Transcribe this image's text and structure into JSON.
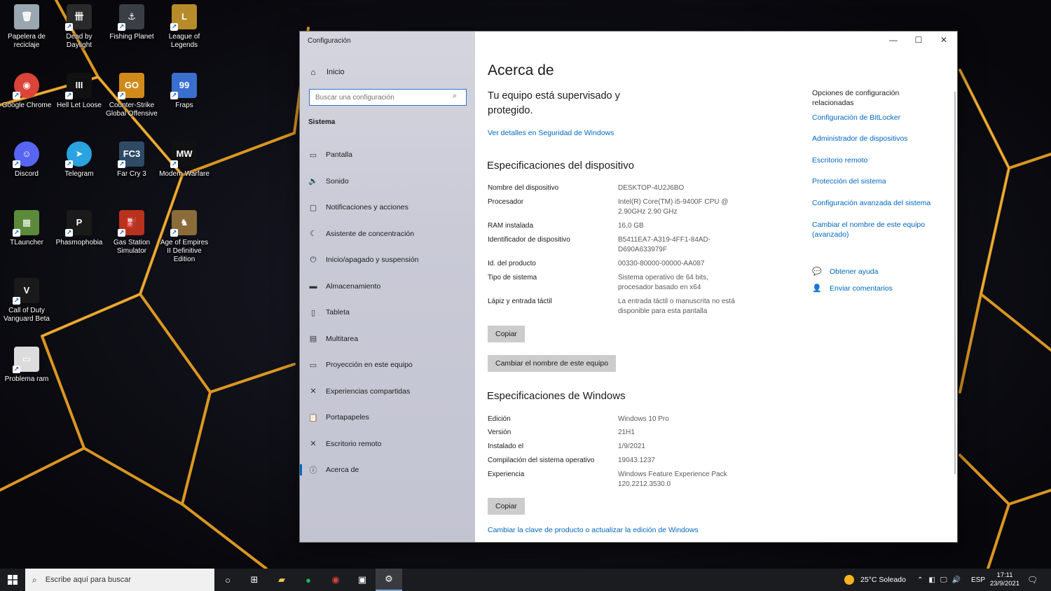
{
  "desktop": {
    "icons": [
      {
        "label": "Papelera de reciclaje",
        "glyph": "🗑",
        "color": "#9aa6b0"
      },
      {
        "label": "Dead by Daylight",
        "glyph": "卌",
        "color": "#2a2a2a"
      },
      {
        "label": "Fishing Planet",
        "glyph": "⚓",
        "color": "#3a3f45"
      },
      {
        "label": "League of Legends",
        "glyph": "L",
        "color": "#b78a2a"
      },
      {
        "label": "Google Chrome",
        "glyph": "◉",
        "color": "#db4437"
      },
      {
        "label": "Hell Let Loose",
        "glyph": "III",
        "color": "#111111"
      },
      {
        "label": "Counter-Strike Global Offensive",
        "glyph": "GO",
        "color": "#d08a1a"
      },
      {
        "label": "Fraps",
        "glyph": "99",
        "color": "#3a6fd0"
      },
      {
        "label": "Discord",
        "glyph": "☺",
        "color": "#5865f2"
      },
      {
        "label": "Telegram",
        "glyph": "➤",
        "color": "#2aa3e0"
      },
      {
        "label": "Far Cry 3",
        "glyph": "FC3",
        "color": "#2f4a66"
      },
      {
        "label": "Modern Warfare",
        "glyph": "MW",
        "color": "#111111"
      },
      {
        "label": "TLauncher",
        "glyph": "▦",
        "color": "#5c8a3a"
      },
      {
        "label": "Phasmophobia",
        "glyph": "P",
        "color": "#1a1a1a"
      },
      {
        "label": "Gas Station Simulator",
        "glyph": "⛽",
        "color": "#b8321e"
      },
      {
        "label": "Age of Empires II Definitive Edition",
        "glyph": "♞",
        "color": "#8a6b3a"
      },
      {
        "label": "Call of Duty Vanguard Beta",
        "glyph": "V",
        "color": "#1a1a1a"
      },
      {
        "label": "Problema ram",
        "glyph": "▭",
        "color": "#dcdcdc"
      }
    ]
  },
  "window": {
    "app_title": "Configuración",
    "controls": {
      "minimize": "—",
      "maximize": "☐",
      "close": "✕"
    },
    "sidebar": {
      "home": {
        "icon": "⌂",
        "label": "Inicio"
      },
      "search_placeholder": "Buscar una configuración",
      "search_icon": "⌕",
      "section": "Sistema",
      "items": [
        {
          "icon": "▭",
          "label": "Pantalla"
        },
        {
          "icon": "🔈",
          "label": "Sonido"
        },
        {
          "icon": "▢",
          "label": "Notificaciones y acciones"
        },
        {
          "icon": "☾",
          "label": "Asistente de concentración"
        },
        {
          "icon": "⏻",
          "label": "Inicio/apagado y suspensión"
        },
        {
          "icon": "▬",
          "label": "Almacenamiento"
        },
        {
          "icon": "▯",
          "label": "Tableta"
        },
        {
          "icon": "▤",
          "label": "Multitarea"
        },
        {
          "icon": "▭",
          "label": "Proyección en este equipo"
        },
        {
          "icon": "✕",
          "label": "Experiencias compartidas"
        },
        {
          "icon": "📋",
          "label": "Portapapeles"
        },
        {
          "icon": "✕",
          "label": "Escritorio remoto"
        },
        {
          "icon": "ⓘ",
          "label": "Acerca de"
        }
      ]
    },
    "content": {
      "title": "Acerca de",
      "protect_text": "Tu equipo está supervisado y protegido.",
      "security_link": "Ver detalles en Seguridad de Windows",
      "device_specs_title": "Especificaciones del dispositivo",
      "device_specs": [
        {
          "label": "Nombre del dispositivo",
          "value": "DESKTOP-4U2J6BO"
        },
        {
          "label": "Procesador",
          "value": "Intel(R) Core(TM) i5-9400F CPU @ 2.90GHz   2.90 GHz"
        },
        {
          "label": "RAM instalada",
          "value": "16,0 GB"
        },
        {
          "label": "Identificador de dispositivo",
          "value": "B5411EA7-A319-4FF1-84AD-D690A633979F"
        },
        {
          "label": "Id. del producto",
          "value": "00330-80000-00000-AA087"
        },
        {
          "label": "Tipo de sistema",
          "value": "Sistema operativo de 64 bits, procesador basado en x64"
        },
        {
          "label": "Lápiz y entrada táctil",
          "value": "La entrada táctil o manuscrita no está disponible para esta pantalla"
        }
      ],
      "copy_label": "Copiar",
      "rename_label": "Cambiar el nombre de este equipo",
      "windows_specs_title": "Especificaciones de Windows",
      "windows_specs": [
        {
          "label": "Edición",
          "value": "Windows 10 Pro"
        },
        {
          "label": "Versión",
          "value": "21H1"
        },
        {
          "label": "Instalado el",
          "value": "1/9/2021"
        },
        {
          "label": "Compilación del sistema operativo",
          "value": "19043.1237"
        },
        {
          "label": "Experiencia",
          "value": "Windows Feature Experience Pack 120.2212.3530.0"
        }
      ],
      "copy2_label": "Copiar",
      "product_key_link": "Cambiar la clave de producto o actualizar la edición de Windows",
      "related": {
        "title": "Opciones de configuración relacionadas",
        "links": [
          "Configuración de BitLocker",
          "Administrador de dispositivos",
          "Escritorio remoto",
          "Protección del sistema",
          "Configuración avanzada del sistema",
          "Cambiar el nombre de este equipo (avanzado)"
        ]
      },
      "help": {
        "icon": "💬",
        "label": "Obtener ayuda"
      },
      "feedback": {
        "icon": "👤",
        "label": "Enviar comentarios"
      }
    }
  },
  "taskbar": {
    "search_placeholder": "Escribe aquí para buscar",
    "apps": [
      {
        "name": "task-view",
        "icon": "○"
      },
      {
        "name": "widgets",
        "icon": "⊞"
      },
      {
        "name": "file-explorer",
        "icon": "▰"
      },
      {
        "name": "spotify",
        "icon": "●"
      },
      {
        "name": "chrome",
        "icon": "◉"
      },
      {
        "name": "fraps",
        "icon": "▣"
      },
      {
        "name": "settings",
        "icon": "⚙"
      }
    ],
    "weather": "25°C  Soleado",
    "language": "ESP",
    "time": "17:11",
    "date": "23/9/2021",
    "accent": "#7aa8d8"
  }
}
